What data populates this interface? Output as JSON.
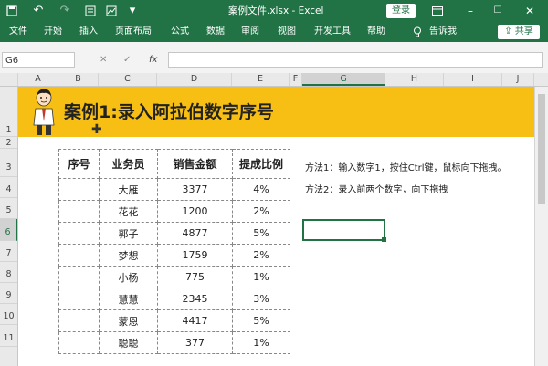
{
  "titlebar": {
    "save_icon": "save-icon",
    "undo": "↶",
    "redo": "↷",
    "title": "案例文件.xlsx  -  Excel",
    "login": "登录",
    "min": "–",
    "max": "☐",
    "close": "✕"
  },
  "ribbon": {
    "tabs": [
      "文件",
      "开始",
      "插入",
      "页面布局",
      "公式",
      "数据",
      "审阅",
      "视图",
      "开发工具",
      "帮助",
      "告诉我"
    ],
    "share": "共享"
  },
  "formula_bar": {
    "name_box": "G6",
    "cancel": "✕",
    "confirm": "✓",
    "fx": "fx"
  },
  "columns": [
    "A",
    "B",
    "C",
    "D",
    "E",
    "F",
    "G",
    "H",
    "I",
    "J"
  ],
  "rows": [
    "1",
    "2",
    "3",
    "4",
    "5",
    "6",
    "7",
    "8",
    "9",
    "10",
    "11"
  ],
  "selected_cell": {
    "col": "G",
    "row": "6"
  },
  "banner_title": "案例1:录入阿拉伯数字序号",
  "table": {
    "headers": [
      "序号",
      "业务员",
      "销售金额",
      "提成比例"
    ],
    "rows": [
      [
        "",
        "大雁",
        "3377",
        "4%"
      ],
      [
        "",
        "花花",
        "1200",
        "2%"
      ],
      [
        "",
        "郭子",
        "4877",
        "5%"
      ],
      [
        "",
        "梦想",
        "1759",
        "2%"
      ],
      [
        "",
        "小杨",
        "775",
        "1%"
      ],
      [
        "",
        "慧慧",
        "2345",
        "3%"
      ],
      [
        "",
        "蒙恩",
        "4417",
        "5%"
      ],
      [
        "",
        "聪聪",
        "377",
        "1%"
      ]
    ]
  },
  "notes": [
    "方法1：输入数字1，按住Ctrl键，鼠标向下拖拽。",
    "方法2：录入前两个数字，向下拖拽"
  ],
  "colors": {
    "excel_green": "#217346",
    "banner": "#f7bf14"
  }
}
